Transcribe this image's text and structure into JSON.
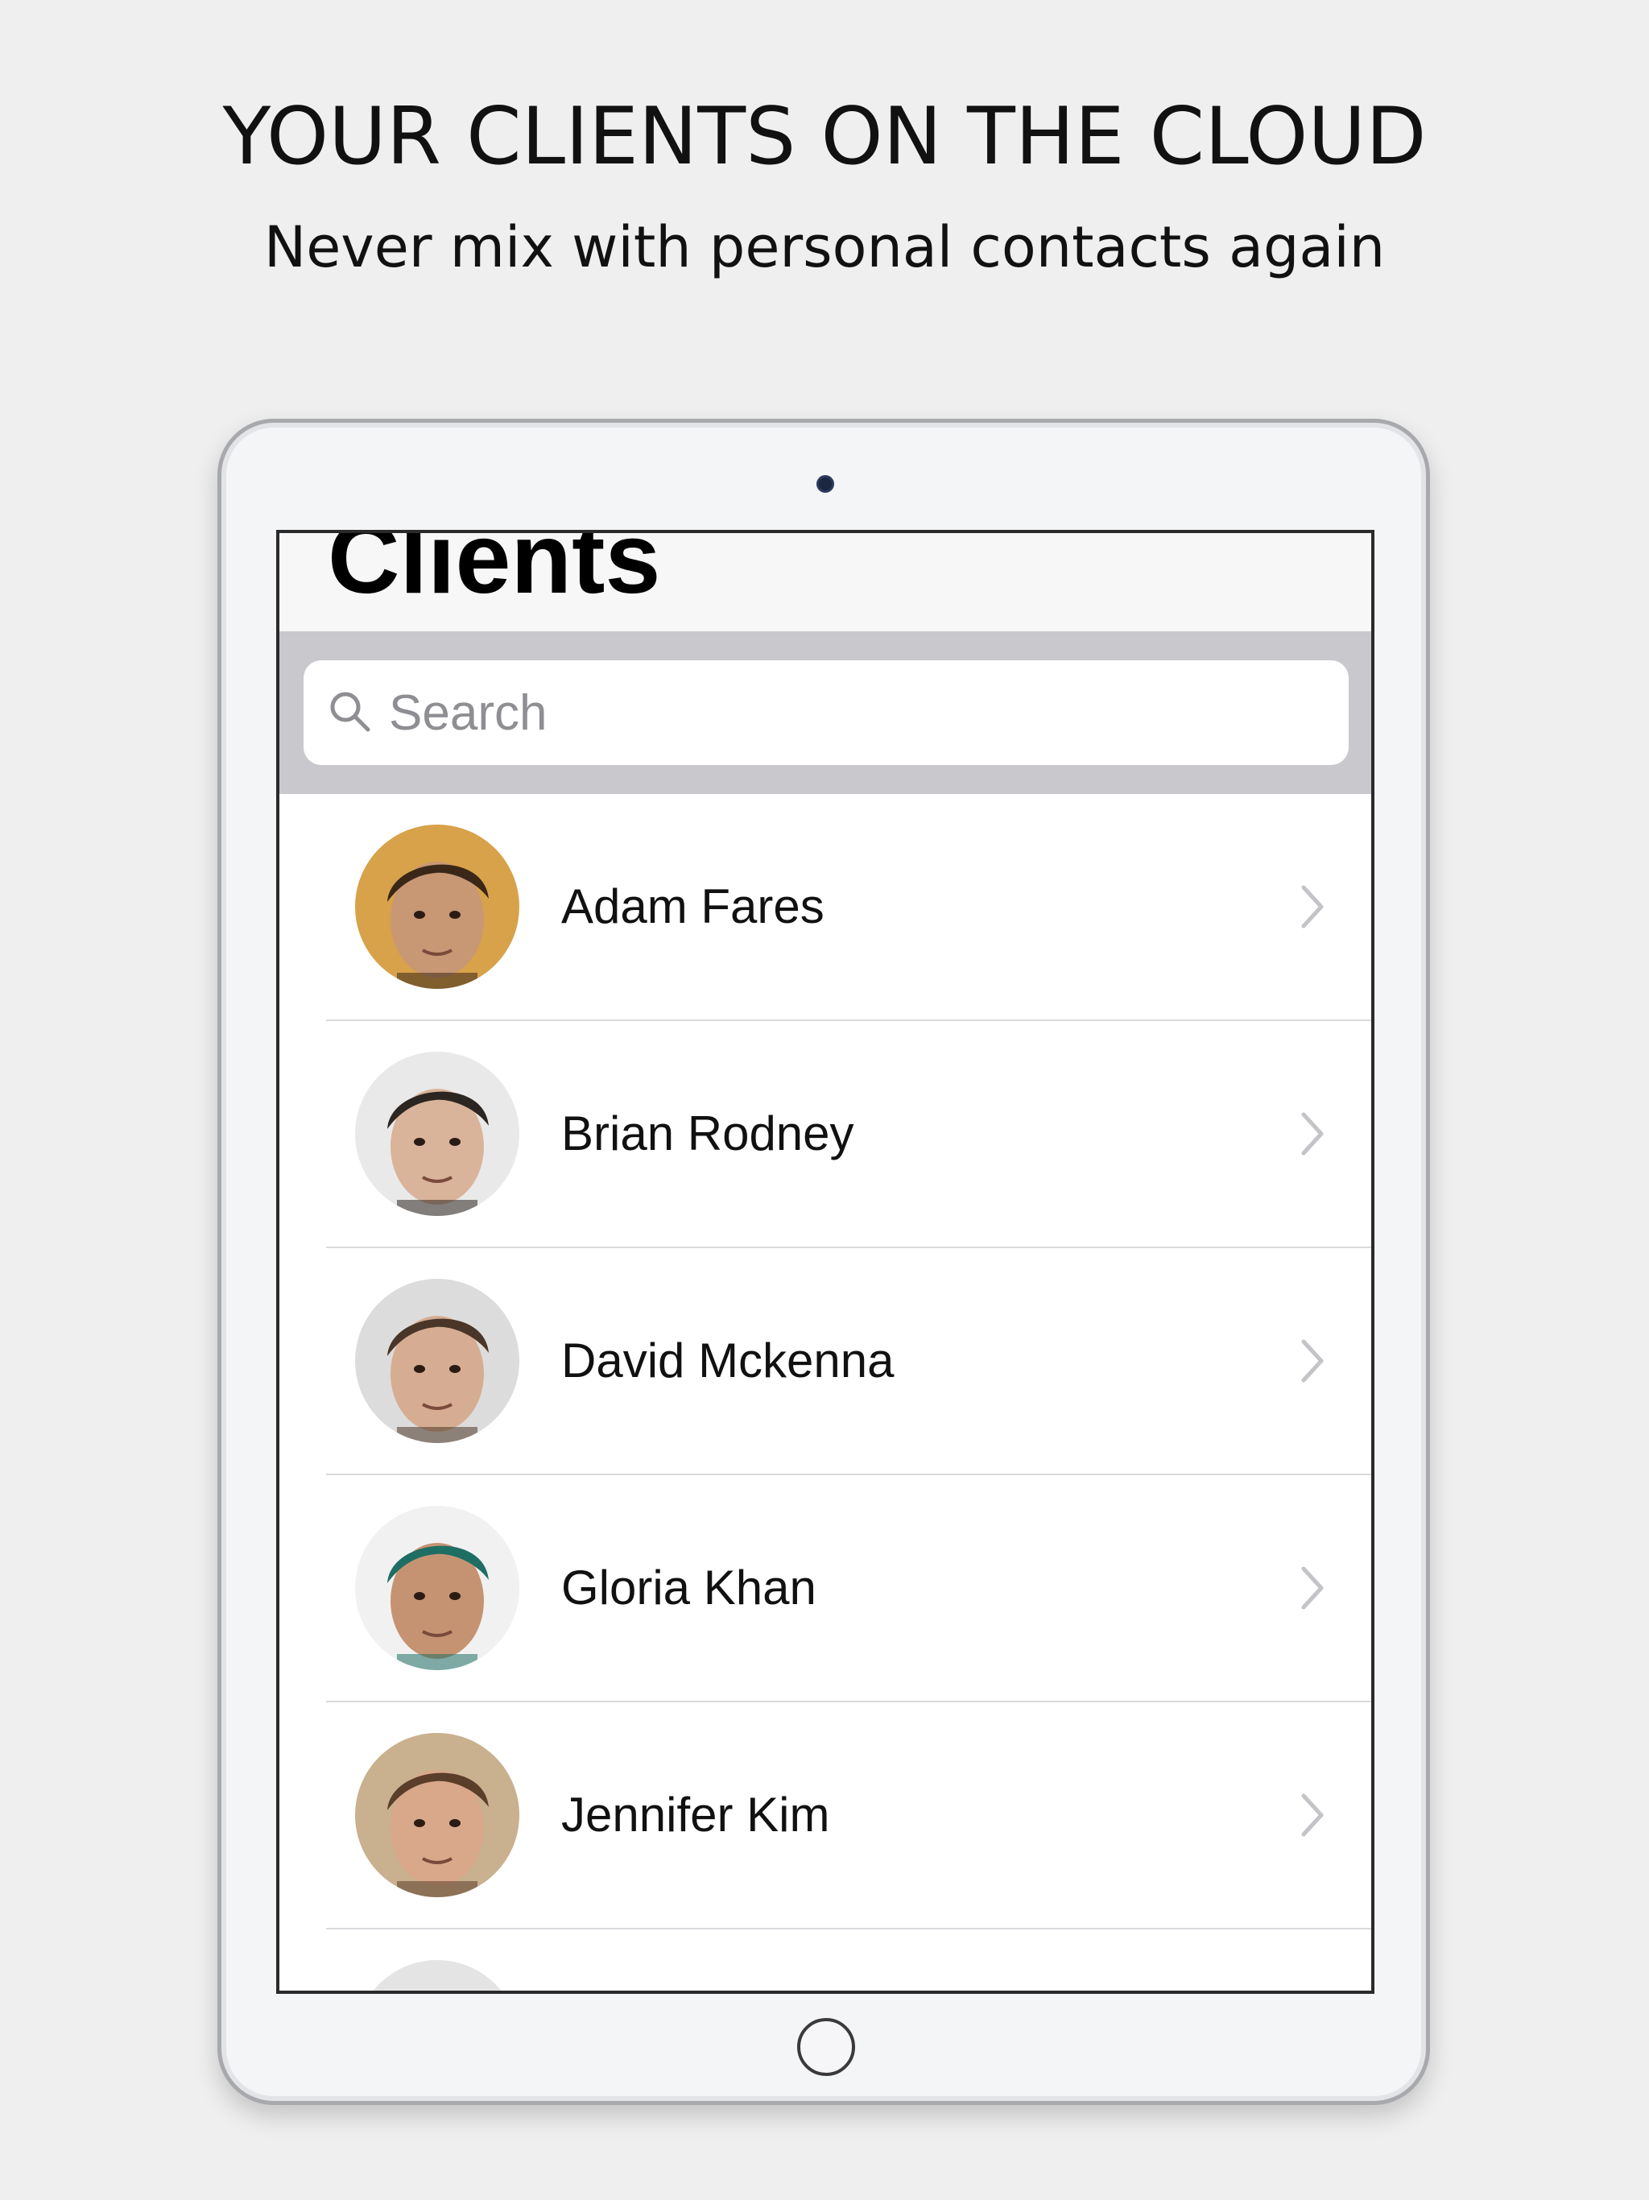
{
  "promo": {
    "headline": "YOUR CLIENTS ON THE CLOUD",
    "subline": "Never mix with personal contacts again"
  },
  "screen": {
    "title": "Clients",
    "search": {
      "placeholder": "Search",
      "icon": "search-icon"
    },
    "clients": [
      {
        "name": "Adam Fares",
        "avatar_skin": "#c89774",
        "avatar_hair": "#3a2718",
        "avatar_bg": "#d8a24a"
      },
      {
        "name": "Brian Rodney",
        "avatar_skin": "#d9b39a",
        "avatar_hair": "#2c2622",
        "avatar_bg": "#e9e9e9"
      },
      {
        "name": "David Mckenna",
        "avatar_skin": "#d6ad92",
        "avatar_hair": "#4a3628",
        "avatar_bg": "#dcdcdc"
      },
      {
        "name": "Gloria Khan",
        "avatar_skin": "#c69372",
        "avatar_hair": "#1f6e64",
        "avatar_bg": "#f1f1f1"
      },
      {
        "name": "Jennifer Kim",
        "avatar_skin": "#d9a88a",
        "avatar_hair": "#5a3e2a",
        "avatar_bg": "#c9b08e"
      },
      {
        "name": "",
        "avatar_skin": "#c99a8a",
        "avatar_hair": "#9a6a70",
        "avatar_bg": "#e4e4e4"
      }
    ],
    "chevron_icon": "chevron-right-icon"
  }
}
